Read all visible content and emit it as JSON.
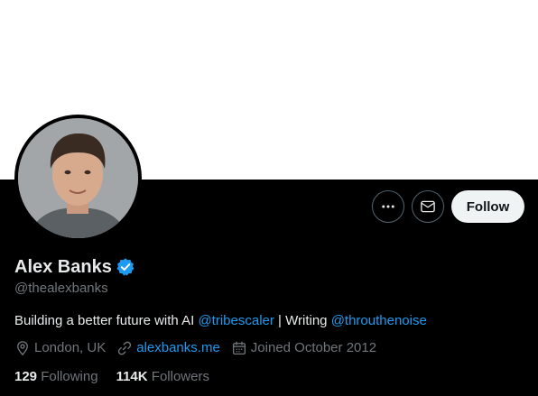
{
  "profile": {
    "display_name": "Alex Banks",
    "handle": "@thealexbanks",
    "verified": true,
    "bio": {
      "text_1": "Building a better future with AI ",
      "mention_1": "@tribescaler",
      "text_2": " | Writing ",
      "mention_2": "@throuthenoise"
    },
    "location": "London, UK",
    "website": "alexbanks.me",
    "joined": "Joined October 2012",
    "following_count": "129",
    "following_label": "Following",
    "followers_count": "114K",
    "followers_label": "Followers"
  },
  "actions": {
    "more_icon": "more-horizontal-icon",
    "message_icon": "envelope-icon",
    "follow_label": "Follow"
  },
  "colors": {
    "background": "#000000",
    "banner": "#ffffff",
    "accent": "#1d9bf0",
    "text_primary": "#e7e9ea",
    "text_secondary": "#71767b",
    "follow_bg": "#eff3f4"
  }
}
